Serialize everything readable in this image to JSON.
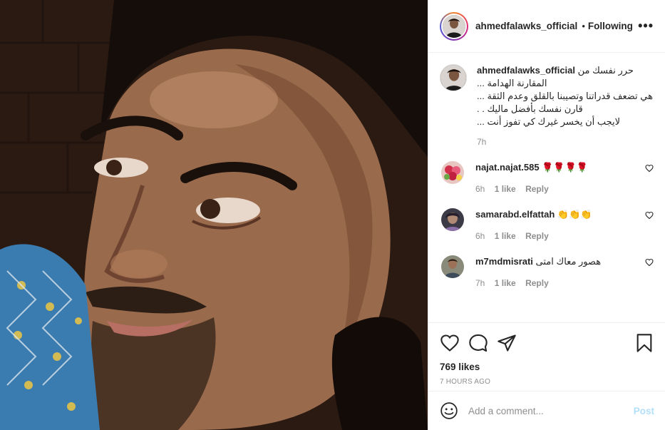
{
  "post": {
    "photo_alt": "post-photo",
    "author": {
      "username": "ahmedfalawks_official",
      "follow_state": "Following",
      "separator": "•"
    },
    "more_options": "•••"
  },
  "caption": {
    "username": "ahmedfalawks_official",
    "lines": [
      "حرر نفسك من",
      "المقارنة الهدامة ...",
      "هي تضعف قدراتنا وتصيبنا بالقلق وعدم الثقة ...",
      "قارن نفسك بأفضل ماليك . .",
      "لايجب أن يخسر غيرك كي تفوز أنت ..."
    ],
    "time": "7h"
  },
  "comments": [
    {
      "username": "najat.najat.585",
      "text": "🌹🌹🌹🌹",
      "time": "6h",
      "likes": "1 like",
      "reply": "Reply"
    },
    {
      "username": "samarabd.elfattah",
      "text": "👏👏👏",
      "time": "6h",
      "likes": "1 like",
      "reply": "Reply"
    },
    {
      "username": "m7mdmisrati",
      "text": "هصور معاك امتى",
      "time": "7h",
      "likes": "1 like",
      "reply": "Reply"
    }
  ],
  "actions": {
    "likes": "769 likes",
    "posted_ago": "7 HOURS AGO"
  },
  "add_comment": {
    "placeholder": "Add a comment...",
    "post_label": "Post"
  },
  "icons": {
    "like": "heart-icon",
    "comment": "comment-icon",
    "share": "share-icon",
    "save": "bookmark-icon",
    "emoji": "emoji-icon",
    "more": "more-options-icon"
  },
  "colors": {
    "post_button_disabled": "#b2dffc",
    "text": "#262626",
    "muted": "#8e8e8e",
    "divider": "#efefef"
  }
}
